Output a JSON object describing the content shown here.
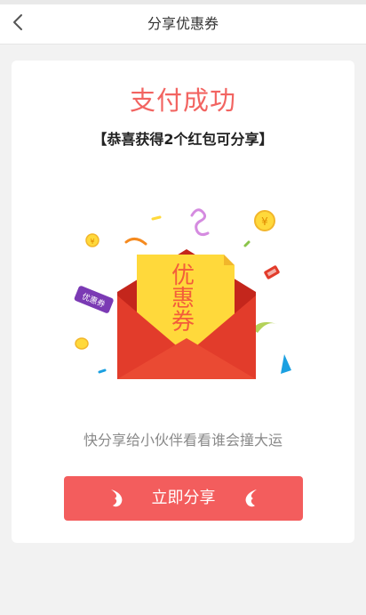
{
  "header": {
    "title": "分享优惠券",
    "back_icon": "chevron-left-icon"
  },
  "card": {
    "success_title": "支付成功",
    "subtitle": "【恭喜获得2个红包可分享】",
    "illustration": {
      "coupon_text": "优惠券",
      "ribbon_text": "优惠券",
      "coin_symbol": "¥"
    },
    "share_tip": "快分享给小伙伴看看谁会撞大运",
    "share_button_label": "立即分享"
  },
  "colors": {
    "accent": "#f35d5d",
    "title_red": "#f26461",
    "envelope_red": "#e23c2b",
    "coupon_yellow": "#ffd93b"
  }
}
